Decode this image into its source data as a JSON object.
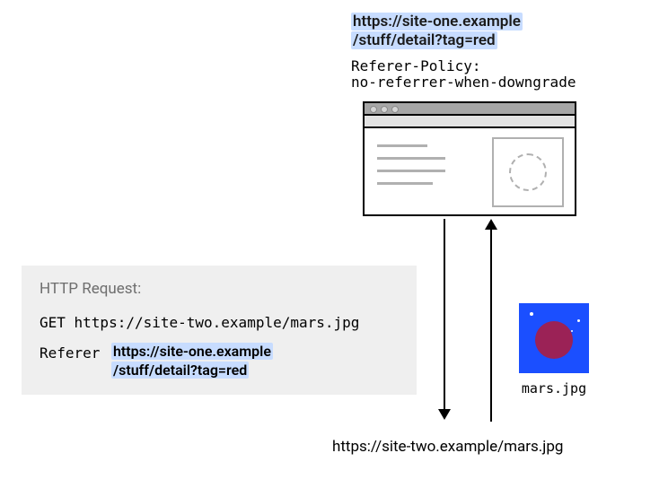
{
  "top_url_line1": "https://site-one.example",
  "top_url_line2": "/stuff/detail?tag=red",
  "policy_text": "Referer-Policy:\nno-referrer-when-downgrade",
  "request": {
    "title": "HTTP Request:",
    "get_line": "GET https://site-two.example/mars.jpg",
    "referer_label": "Referer",
    "referer_line1": "https://site-one.example",
    "referer_line2": "/stuff/detail?tag=red"
  },
  "mars_label": "mars.jpg",
  "bottom_url": "https://site-two.example/mars.jpg"
}
